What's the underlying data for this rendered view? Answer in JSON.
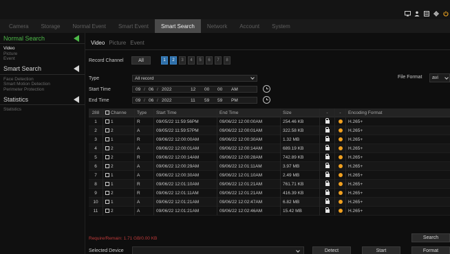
{
  "nav": {
    "items": [
      {
        "label": "Camera",
        "active": false
      },
      {
        "label": "Storage",
        "active": false
      },
      {
        "label": "Normal Event",
        "active": false
      },
      {
        "label": "Smart Event",
        "active": false
      },
      {
        "label": "Smart Search",
        "active": true
      },
      {
        "label": "Network",
        "active": false
      },
      {
        "label": "Account",
        "active": false
      },
      {
        "label": "System",
        "active": false
      }
    ]
  },
  "top_icons": [
    "monitor-icon",
    "user-icon",
    "grid-icon",
    "gear-icon",
    "power-icon"
  ],
  "sidebar": {
    "sections": [
      {
        "title": "Normal Search",
        "active": true,
        "items": [
          "Video",
          "Picture",
          "Event"
        ]
      },
      {
        "title": "Smart Search",
        "active": false,
        "items": [
          "Face Detection",
          "Smart Motion Detection",
          "Perimeter Protection"
        ]
      },
      {
        "title": "Statistics",
        "active": false,
        "items": [
          "Statistics"
        ]
      }
    ]
  },
  "subtabs": [
    "Video",
    "Picture",
    "Event"
  ],
  "filters": {
    "record_channel_label": "Record Channel",
    "all_label": "All",
    "channels": [
      {
        "label": "1",
        "selected": true
      },
      {
        "label": "2",
        "selected": true
      },
      {
        "label": "3",
        "selected": false
      },
      {
        "label": "4",
        "selected": false
      },
      {
        "label": "5",
        "selected": false
      },
      {
        "label": "6",
        "selected": false
      },
      {
        "label": "7",
        "selected": false
      },
      {
        "label": "8",
        "selected": false
      }
    ],
    "type_label": "Type",
    "type_value": "All record",
    "start_time_label": "Start Time",
    "start": {
      "month": "09",
      "day": "06",
      "year": "2022",
      "hour": "12",
      "min": "00",
      "sec": "00",
      "ampm": "AM"
    },
    "end_time_label": "End Time",
    "end": {
      "month": "09",
      "day": "06",
      "year": "2022",
      "hour": "11",
      "min": "59",
      "sec": "59",
      "ampm": "PM"
    },
    "file_format_label": "File Format",
    "file_format_value": "avi"
  },
  "table": {
    "count": "288",
    "headers": [
      "Channe",
      "Type",
      "Start Time",
      "End Time",
      "Size",
      "-",
      "-",
      "Encoding Format"
    ],
    "rows": [
      [
        "1",
        "1",
        "R",
        "09/05/22 11:59:56PM",
        "09/06/22 12:00:00AM",
        "254.46 KB",
        "H.265+"
      ],
      [
        "2",
        "2",
        "A",
        "09/05/22 11:59:57PM",
        "09/06/22 12:00:01AM",
        "322.58 KB",
        "H.265+"
      ],
      [
        "3",
        "1",
        "R",
        "09/06/22 12:00:00AM",
        "09/06/22 12:00:30AM",
        "1.32 MB",
        "H.265+"
      ],
      [
        "4",
        "2",
        "A",
        "09/06/22 12:00:01AM",
        "09/06/22 12:00:14AM",
        "689.19 KB",
        "H.265+"
      ],
      [
        "5",
        "2",
        "R",
        "09/06/22 12:00:14AM",
        "09/06/22 12:00:28AM",
        "742.89 KB",
        "H.265+"
      ],
      [
        "6",
        "2",
        "A",
        "09/06/22 12:00:29AM",
        "09/06/22 12:01:11AM",
        "3.97 MB",
        "H.265+"
      ],
      [
        "7",
        "1",
        "A",
        "09/06/22 12:00:30AM",
        "09/06/22 12:01:10AM",
        "2.49 MB",
        "H.265+"
      ],
      [
        "8",
        "1",
        "R",
        "09/06/22 12:01:10AM",
        "09/06/22 12:01:21AM",
        "761.71 KB",
        "H.265+"
      ],
      [
        "9",
        "2",
        "R",
        "09/06/22 12:01:11AM",
        "09/06/22 12:01:21AM",
        "416.39 KB",
        "H.265+"
      ],
      [
        "10",
        "1",
        "A",
        "09/06/22 12:01:21AM",
        "09/06/22 12:02:47AM",
        "6.82 MB",
        "H.265+"
      ],
      [
        "11",
        "2",
        "A",
        "09/06/22 12:01:21AM",
        "09/06/22 12:02:46AM",
        "15.42 MB",
        "H.265+"
      ]
    ]
  },
  "bottom": {
    "required_text": "Require/Remain: 1.71 GB/0.00 KB",
    "search_label": "Search",
    "selected_device_label": "Selected Device",
    "detect_label": "Detect",
    "start_label": "Start",
    "format_label": "Format"
  },
  "colors": {
    "accent_green": "#4db848",
    "channel_selected": "#2f6fa8",
    "warning_red": "#c03a3a",
    "event_dot": "#f0a020"
  }
}
